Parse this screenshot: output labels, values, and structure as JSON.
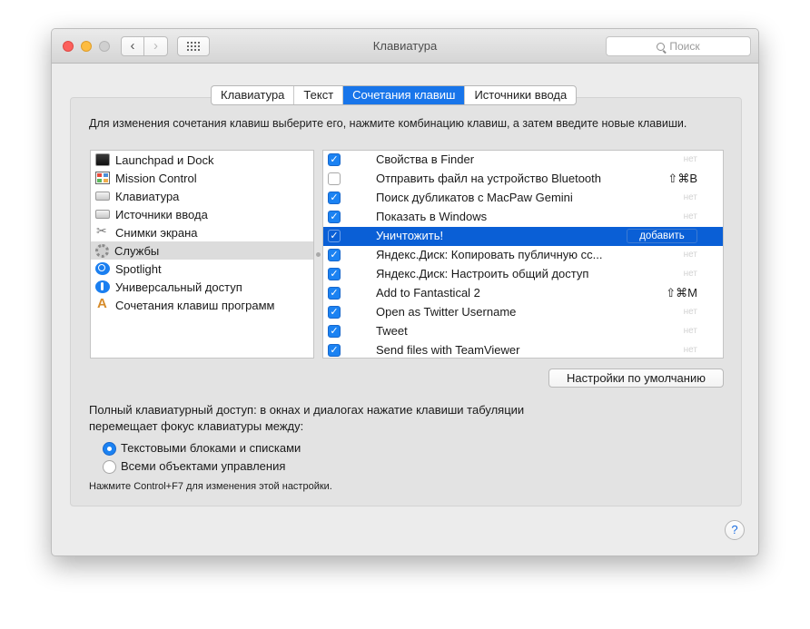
{
  "window": {
    "title": "Клавиатура",
    "search_placeholder": "Поиск"
  },
  "tabs": [
    {
      "label": "Клавиатура",
      "active": false
    },
    {
      "label": "Текст",
      "active": false
    },
    {
      "label": "Сочетания клавиш",
      "active": true
    },
    {
      "label": "Источники ввода",
      "active": false
    }
  ],
  "description": "Для изменения сочетания клавиш выберите его, нажмите комбинацию клавиш, а затем введите новые клавиши.",
  "categories": [
    {
      "label": "Launchpad и Dock",
      "icon": "launchpad-icon"
    },
    {
      "label": "Mission Control",
      "icon": "mission-control-icon"
    },
    {
      "label": "Клавиатура",
      "icon": "keyboard-icon"
    },
    {
      "label": "Источники ввода",
      "icon": "keyboard-icon"
    },
    {
      "label": "Снимки экрана",
      "icon": "screenshot-icon"
    },
    {
      "label": "Службы",
      "icon": "gear-icon",
      "selected": true
    },
    {
      "label": "Spotlight",
      "icon": "spotlight-icon"
    },
    {
      "label": "Универсальный доступ",
      "icon": "accessibility-icon"
    },
    {
      "label": "Сочетания клавиш программ",
      "icon": "app-shortcuts-icon"
    }
  ],
  "shortcuts": [
    {
      "label": "Свойства в Finder",
      "checked": true,
      "key": "нет"
    },
    {
      "label": "Отправить файл на устройство Bluetooth",
      "checked": false,
      "key": "⇧⌘B"
    },
    {
      "label": "Поиск дубликатов с MacPaw Gemini",
      "checked": true,
      "key": "нет"
    },
    {
      "label": "Показать в Windows",
      "checked": true,
      "key": "нет"
    },
    {
      "label": "Уничтожить!",
      "checked": true,
      "key": "добавить",
      "selected": true
    },
    {
      "label": "Яндекс.Диск: Копировать публичную сс...",
      "checked": true,
      "key": "нет"
    },
    {
      "label": "Яндекс.Диск: Настроить общий доступ",
      "checked": true,
      "key": "нет"
    },
    {
      "label": "Add to Fantastical 2",
      "checked": true,
      "key": "⇧⌘M"
    },
    {
      "label": "Open as Twitter Username",
      "checked": true,
      "key": "нет"
    },
    {
      "label": "Tweet",
      "checked": true,
      "key": "нет"
    },
    {
      "label": "Send files with TeamViewer",
      "checked": true,
      "key": "нет"
    }
  ],
  "defaults_button": "Настройки по умолчанию",
  "full_access": {
    "text_line1": "Полный клавиатурный доступ: в окнах и диалогах нажатие клавиши табуляции",
    "text_line2": "перемещает фокус клавиатуры между:",
    "option1": "Текстовыми блоками и списками",
    "option2": "Всеми объектами управления",
    "selected": 1,
    "hint": "Нажмите Control+F7 для изменения этой настройки."
  },
  "help_label": "?",
  "colors": {
    "accent": "#1875ea",
    "selection": "#0a5fd6"
  }
}
